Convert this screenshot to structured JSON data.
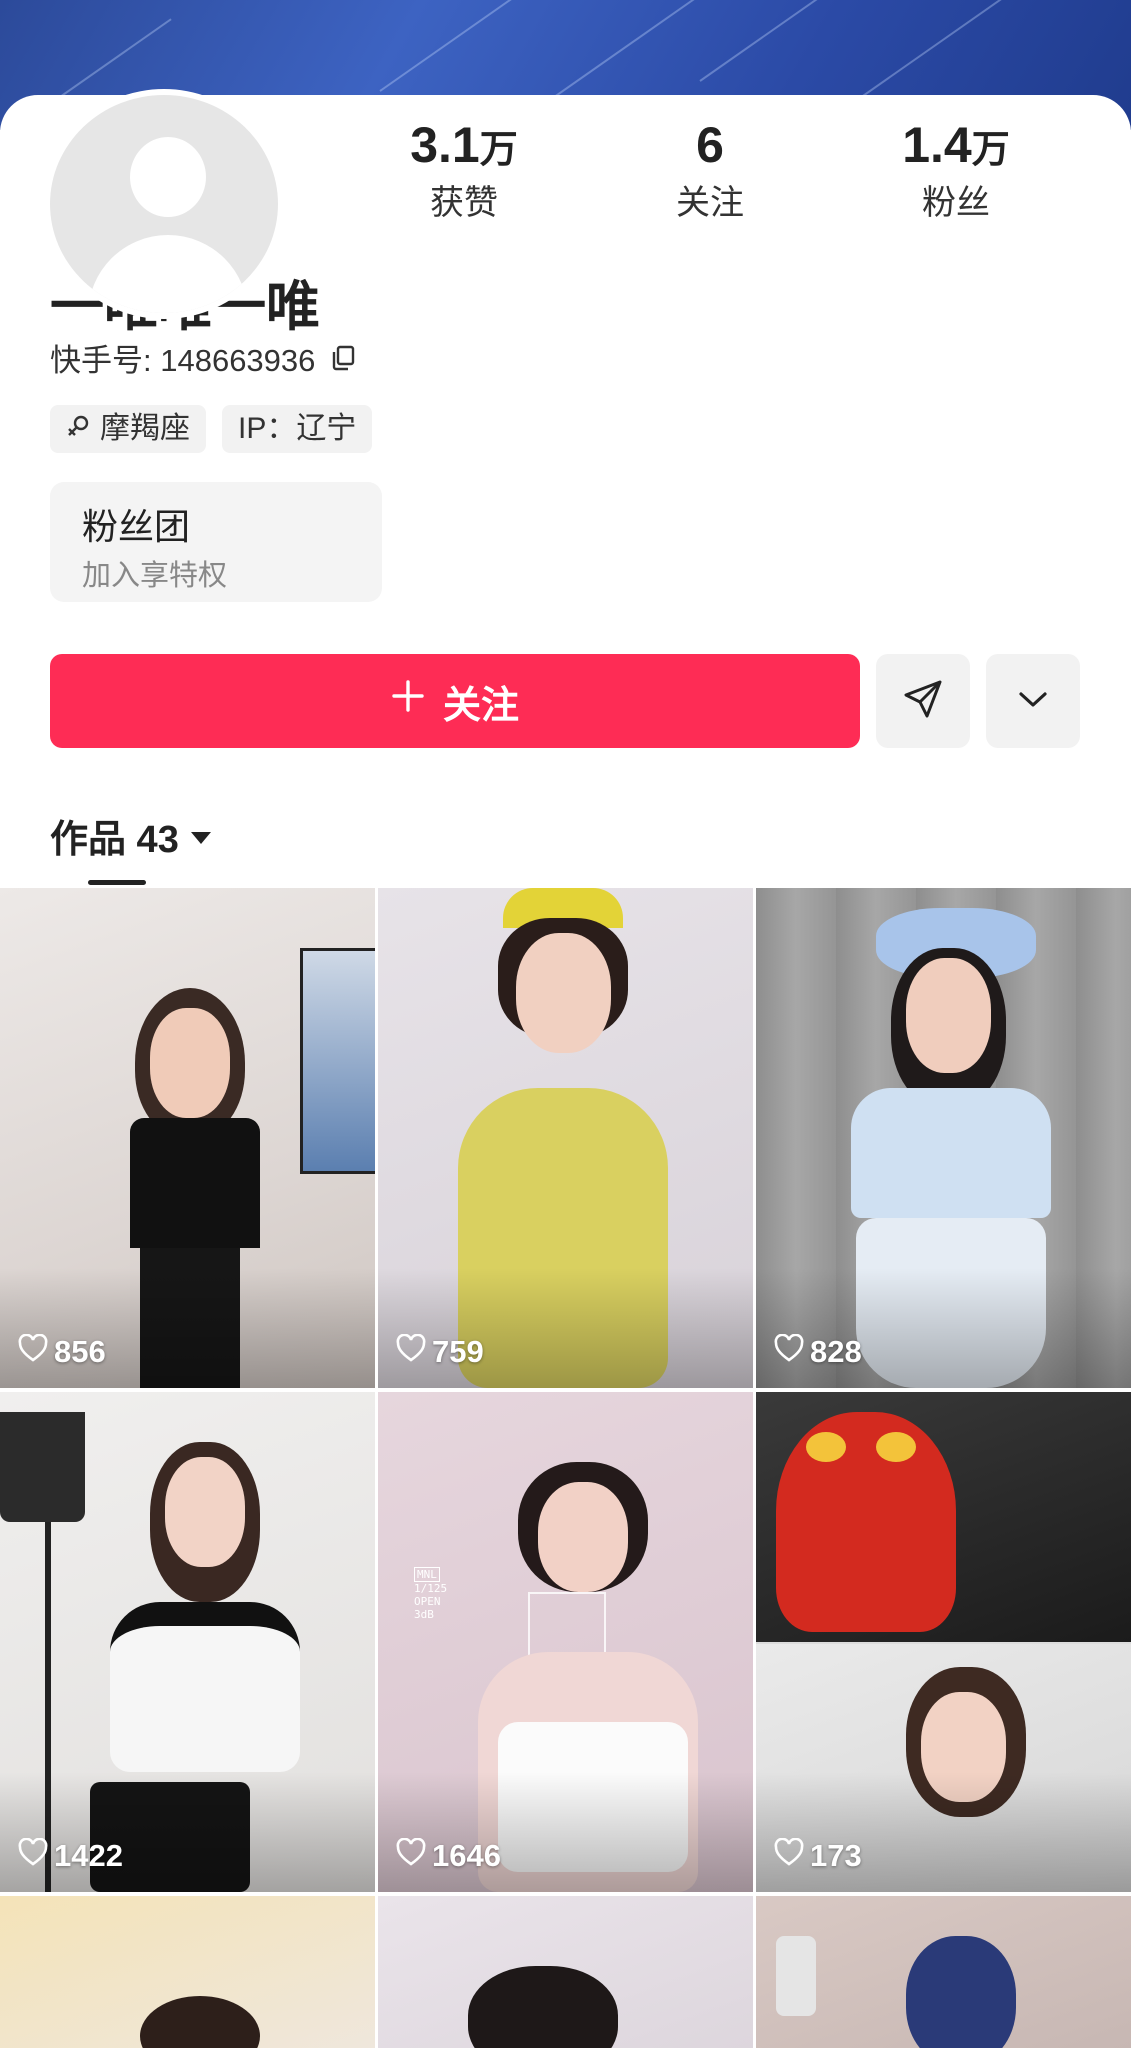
{
  "profile": {
    "name": "一唯唯一唯",
    "kuaishou_id": "快手号: 148663936",
    "tags": [
      {
        "icon": "gender-female-icon",
        "label": "摩羯座"
      },
      {
        "icon": "",
        "label": "IP：辽宁"
      }
    ]
  },
  "stats": [
    {
      "value": "3.1",
      "unit": "万",
      "label": "获赞"
    },
    {
      "value": "6",
      "unit": "",
      "label": "关注"
    },
    {
      "value": "1.4",
      "unit": "万",
      "label": "粉丝"
    }
  ],
  "fan_club": {
    "title": "粉丝团",
    "subtitle": "加入享特权"
  },
  "actions": {
    "follow_label": "关注",
    "share_icon": "send-icon",
    "more_icon": "chevron-down-icon"
  },
  "works_tab": {
    "label": "作品 43"
  },
  "videos": [
    {
      "likes": "856"
    },
    {
      "likes": "759"
    },
    {
      "likes": "828"
    },
    {
      "likes": "1422"
    },
    {
      "likes": "1646"
    },
    {
      "likes": "173"
    }
  ],
  "thumbnail_overlay_text": {
    "camera_readout": [
      "MNL",
      "1/125",
      "OPEN",
      "3dB"
    ]
  },
  "colors": {
    "accent": "#fe2c55",
    "banner": "#2f52ad"
  }
}
